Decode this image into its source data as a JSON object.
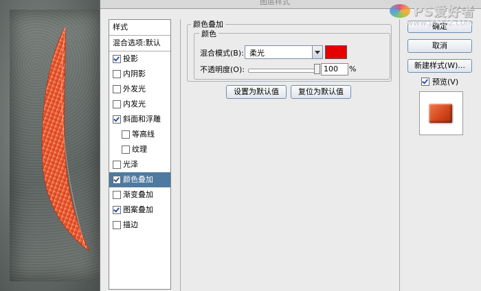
{
  "window": {
    "title": "图层样式"
  },
  "watermark": {
    "text": "PS爱好者",
    "url": "www.psahz.com"
  },
  "style_list": {
    "header": "样式",
    "blend_options": "混合选项:默认",
    "items": [
      {
        "label": "投影",
        "checked": true
      },
      {
        "label": "内阴影",
        "checked": false
      },
      {
        "label": "外发光",
        "checked": false
      },
      {
        "label": "内发光",
        "checked": false
      },
      {
        "label": "斜面和浮雕",
        "checked": true
      },
      {
        "label": "等高线",
        "checked": false,
        "sub": true
      },
      {
        "label": "纹理",
        "checked": false,
        "sub": true
      },
      {
        "label": "光泽",
        "checked": false
      },
      {
        "label": "颜色叠加",
        "checked": true,
        "selected": true
      },
      {
        "label": "渐变叠加",
        "checked": false
      },
      {
        "label": "图案叠加",
        "checked": true
      },
      {
        "label": "描边",
        "checked": false
      }
    ]
  },
  "panel": {
    "section_title": "颜色叠加",
    "group_title": "颜色",
    "blend_mode_label": "混合模式(B):",
    "blend_mode_value": "柔光",
    "overlay_color": "#e60000",
    "opacity_label": "不透明度(O):",
    "opacity_value": "100",
    "opacity_unit": "%",
    "opacity_level": 1.0,
    "set_default_button": "设置为默认值",
    "reset_default_button": "复位为默认值"
  },
  "side": {
    "ok_button": "确定",
    "cancel_button": "取消",
    "new_style_button": "新建样式(W)...",
    "preview_label": "预览(V)",
    "preview_checked": true
  },
  "colors": {
    "selection": "#4f7aa0",
    "feather": "#e8502a"
  }
}
